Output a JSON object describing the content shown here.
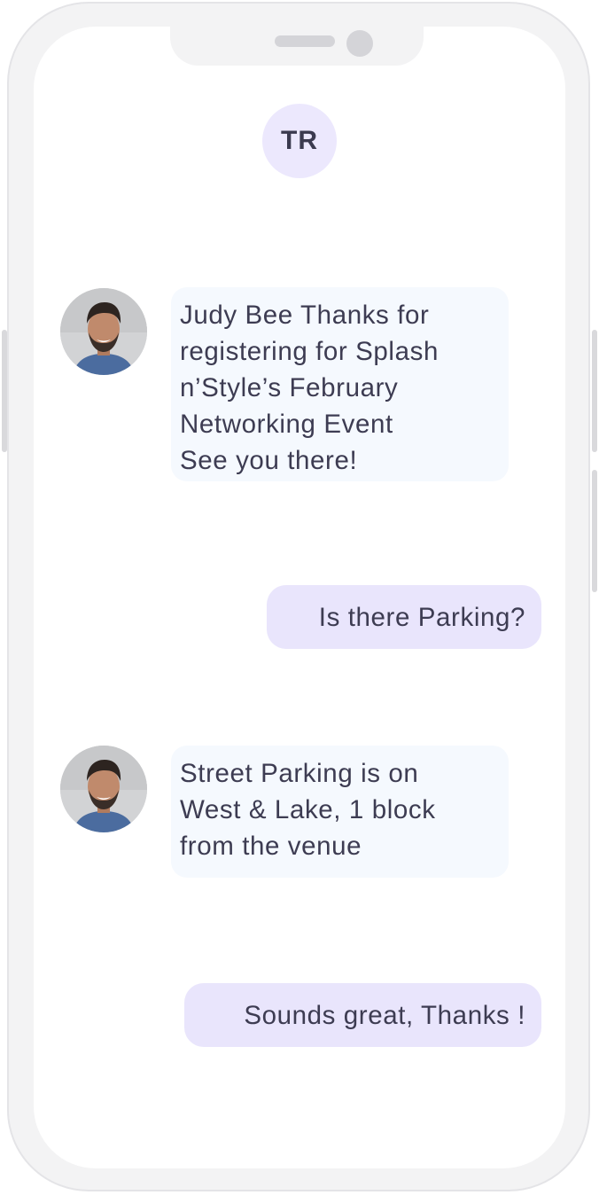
{
  "contact": {
    "initials": "TR"
  },
  "messages": [
    {
      "direction": "incoming",
      "text": "Judy Bee Thanks for\nregistering for Splash\nn’Style’s February\nNetworking Event\nSee you there!"
    },
    {
      "direction": "outgoing",
      "text": "Is there Parking?"
    },
    {
      "direction": "incoming",
      "text": "Street Parking is on\nWest & Lake, 1 block\nfrom the venue"
    },
    {
      "direction": "outgoing",
      "text": "Sounds great, Thanks !"
    }
  ],
  "colors": {
    "incoming_bubble": "#f5f9fe",
    "outgoing_bubble": "#e9e5fc",
    "contact_avatar_bg": "#ece8fd",
    "text": "#3d3c52"
  }
}
